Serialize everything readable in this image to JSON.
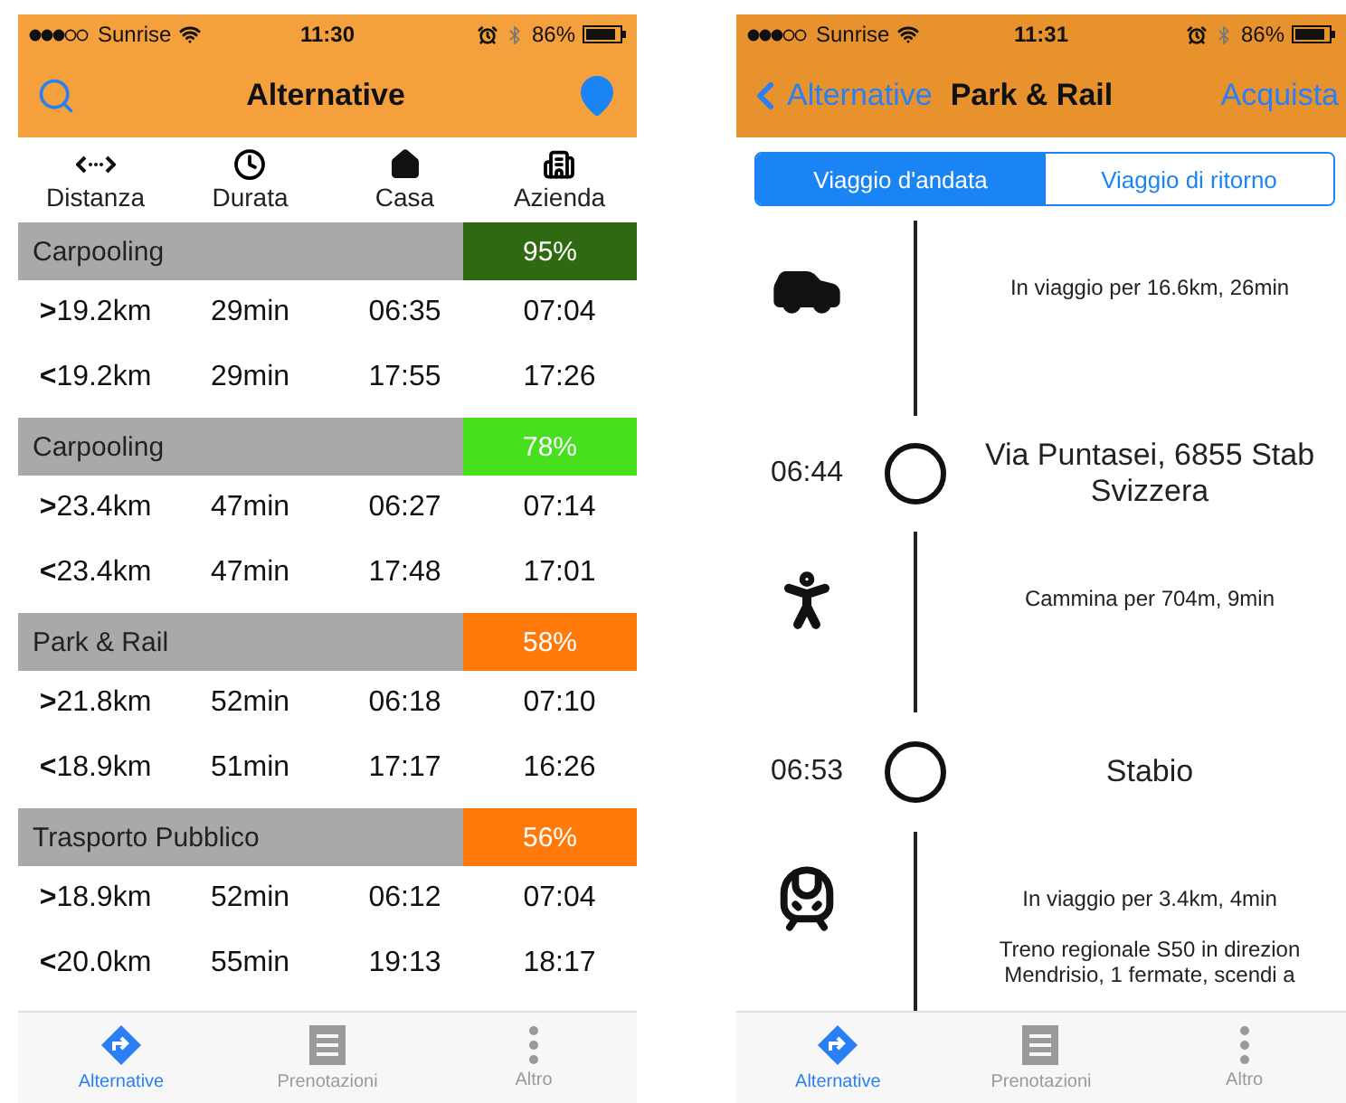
{
  "phones": [
    {
      "status": {
        "carrier": "Sunrise",
        "time": "11:30",
        "battery": "86%"
      },
      "nav": {
        "title": "Alternative"
      },
      "columns": [
        {
          "kind": "distance",
          "label": "Distanza"
        },
        {
          "kind": "duration",
          "label": "Durata"
        },
        {
          "kind": "home",
          "label": "Casa"
        },
        {
          "kind": "company",
          "label": "Azienda"
        }
      ],
      "groups": [
        {
          "name": "Carpooling",
          "score": "95%",
          "color": "#2f6a12",
          "rows": [
            {
              "dir": ">",
              "distance": "19.2km",
              "duration": "29min",
              "home": "06:35",
              "company": "07:04"
            },
            {
              "dir": "<",
              "distance": "19.2km",
              "duration": "29min",
              "home": "17:55",
              "company": "17:26"
            }
          ]
        },
        {
          "name": "Carpooling",
          "score": "78%",
          "color": "#46e01e",
          "rows": [
            {
              "dir": ">",
              "distance": "23.4km",
              "duration": "47min",
              "home": "06:27",
              "company": "07:14"
            },
            {
              "dir": "<",
              "distance": "23.4km",
              "duration": "47min",
              "home": "17:48",
              "company": "17:01"
            }
          ]
        },
        {
          "name": "Park & Rail",
          "score": "58%",
          "color": "#ff7a0a",
          "rows": [
            {
              "dir": ">",
              "distance": "21.8km",
              "duration": "52min",
              "home": "06:18",
              "company": "07:10"
            },
            {
              "dir": "<",
              "distance": "18.9km",
              "duration": "51min",
              "home": "17:17",
              "company": "16:26"
            }
          ]
        },
        {
          "name": "Trasporto Pubblico",
          "score": "56%",
          "color": "#ff7a0a",
          "rows": [
            {
              "dir": ">",
              "distance": "18.9km",
              "duration": "52min",
              "home": "06:12",
              "company": "07:04"
            },
            {
              "dir": "<",
              "distance": "20.0km",
              "duration": "55min",
              "home": "19:13",
              "company": "18:17"
            }
          ]
        }
      ],
      "tabs": [
        {
          "kind": "routes",
          "label": "Alternative",
          "selected": true
        },
        {
          "kind": "bookings",
          "label": "Prenotazioni",
          "selected": false
        },
        {
          "kind": "more",
          "label": "Altro",
          "selected": false
        }
      ]
    },
    {
      "status": {
        "carrier": "Sunrise",
        "time": "11:31",
        "battery": "86%"
      },
      "nav": {
        "back": "Alternative",
        "title": "Park & Rail",
        "action": "Acquista"
      },
      "segments": [
        {
          "label": "Viaggio d'andata",
          "selected": true
        },
        {
          "label": "Viaggio di ritorno",
          "selected": false
        }
      ],
      "timeline": [
        {
          "kind": "car",
          "lines": [
            "In viaggio per 16.6km, 26min"
          ]
        },
        {
          "kind": "stop",
          "time": "06:44",
          "lines": [
            "Via Puntasei, 6855 Stab",
            "Svizzera"
          ]
        },
        {
          "kind": "walk",
          "lines": [
            "Cammina per 704m, 9min"
          ]
        },
        {
          "kind": "stop",
          "time": "06:53",
          "lines": [
            "Stabio"
          ]
        },
        {
          "kind": "train",
          "lines": [
            "In viaggio per 3.4km, 4min",
            "Treno regionale S50 in direzion\nMendrisio, 1 fermate, scendi a"
          ]
        }
      ],
      "tabs": [
        {
          "kind": "routes",
          "label": "Alternative",
          "selected": true
        },
        {
          "kind": "bookings",
          "label": "Prenotazioni",
          "selected": false
        },
        {
          "kind": "more",
          "label": "Altro",
          "selected": false
        }
      ]
    }
  ]
}
